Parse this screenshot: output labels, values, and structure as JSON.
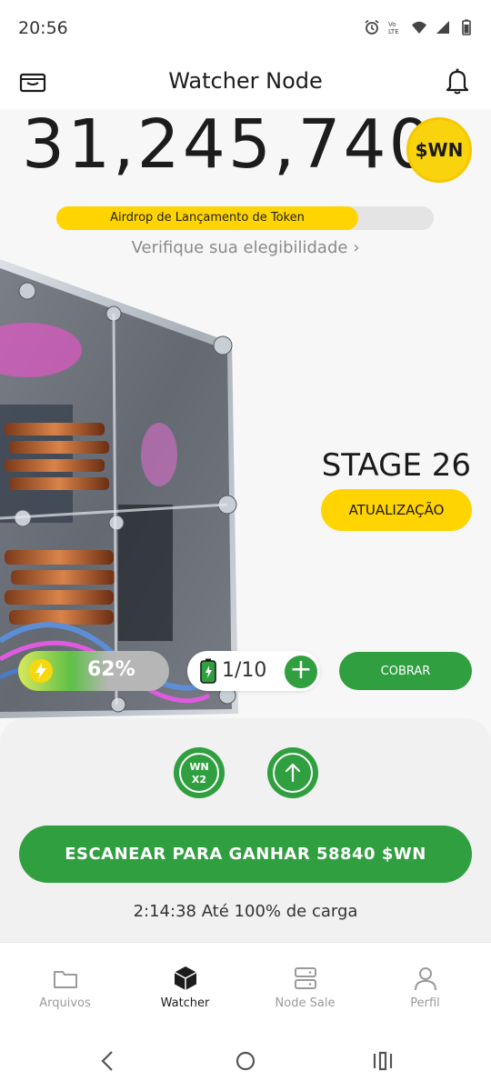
{
  "status_bar": {
    "time": "20:56",
    "icons": [
      "alarm-icon",
      "volte-icon",
      "wifi-icon",
      "signal-icon",
      "battery-icon"
    ],
    "volte_text": "Vo LTE"
  },
  "header": {
    "title": "Watcher Node",
    "left_icon": "wallet-icon",
    "right_icon": "bell-icon"
  },
  "balance": {
    "value": "31,245,740",
    "token_badge": "$WN"
  },
  "airdrop": {
    "label": "Airdrop de Lançamento de Token",
    "progress_fraction": 0.8
  },
  "eligibility_link": "Verifique sua elegibilidade",
  "stage": {
    "label": "STAGE 26",
    "upgrade_button": "ATUALIZAÇÃO"
  },
  "energy": {
    "value": "62%",
    "fraction": 0.62
  },
  "battery": {
    "count": "1/10"
  },
  "collect_button": "COBRAR",
  "boosts": {
    "multiplier_top": "WN",
    "multiplier_bottom": "X2"
  },
  "scan_button": "ESCANEAR PARA GANHAR 58840 $WN",
  "charge_text": "2:14:38 Até 100% de carga",
  "bottom_nav": [
    {
      "label": "Arquivos",
      "icon": "folder-icon",
      "active": false
    },
    {
      "label": "Watcher",
      "icon": "cube-icon",
      "active": true
    },
    {
      "label": "Node Sale",
      "icon": "server-icon",
      "active": false
    },
    {
      "label": "Perfil",
      "icon": "user-icon",
      "active": false
    }
  ],
  "colors": {
    "accent_yellow": "#ffd400",
    "accent_green": "#2f9f3f",
    "background": "#f7f7f7"
  }
}
